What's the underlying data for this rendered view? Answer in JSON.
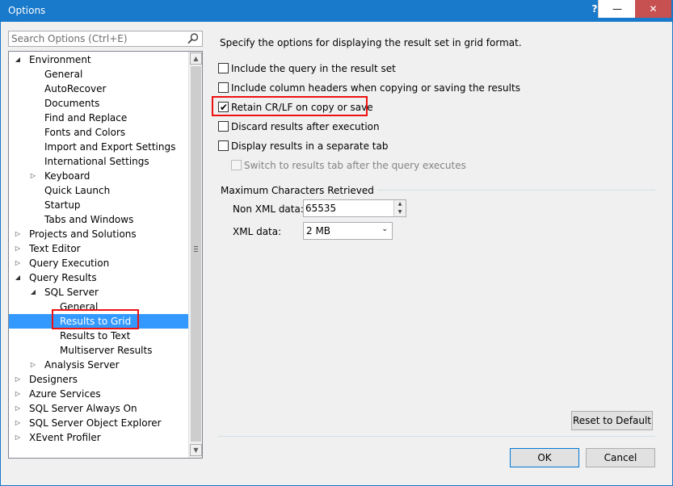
{
  "window": {
    "title": "Options",
    "help_button": "?",
    "minimize_button": "—",
    "close_button": "✕"
  },
  "search": {
    "placeholder": "Search Options (Ctrl+E)"
  },
  "tree": {
    "items": [
      {
        "label": "Environment",
        "level": 0,
        "expander": "expanded"
      },
      {
        "label": "General",
        "level": 1
      },
      {
        "label": "AutoRecover",
        "level": 1
      },
      {
        "label": "Documents",
        "level": 1
      },
      {
        "label": "Find and Replace",
        "level": 1
      },
      {
        "label": "Fonts and Colors",
        "level": 1
      },
      {
        "label": "Import and Export Settings",
        "level": 1
      },
      {
        "label": "International Settings",
        "level": 1
      },
      {
        "label": "Keyboard",
        "level": 1,
        "expander": "collapsed"
      },
      {
        "label": "Quick Launch",
        "level": 1
      },
      {
        "label": "Startup",
        "level": 1
      },
      {
        "label": "Tabs and Windows",
        "level": 1
      },
      {
        "label": "Projects and Solutions",
        "level": 0,
        "expander": "collapsed"
      },
      {
        "label": "Text Editor",
        "level": 0,
        "expander": "collapsed"
      },
      {
        "label": "Query Execution",
        "level": 0,
        "expander": "collapsed"
      },
      {
        "label": "Query Results",
        "level": 0,
        "expander": "expanded"
      },
      {
        "label": "SQL Server",
        "level": 1,
        "expander": "expanded"
      },
      {
        "label": "General",
        "level": 2
      },
      {
        "label": "Results to Grid",
        "level": 2,
        "selected": true
      },
      {
        "label": "Results to Text",
        "level": 2
      },
      {
        "label": "Multiserver Results",
        "level": 2
      },
      {
        "label": "Analysis Server",
        "level": 1,
        "expander": "collapsed"
      },
      {
        "label": "Designers",
        "level": 0,
        "expander": "collapsed"
      },
      {
        "label": "Azure Services",
        "level": 0,
        "expander": "collapsed"
      },
      {
        "label": "SQL Server Always On",
        "level": 0,
        "expander": "collapsed"
      },
      {
        "label": "SQL Server Object Explorer",
        "level": 0,
        "expander": "collapsed"
      },
      {
        "label": "XEvent Profiler",
        "level": 0,
        "expander": "collapsed"
      }
    ]
  },
  "main": {
    "description": "Specify the options for displaying the result set in grid format.",
    "checkboxes": [
      {
        "label": "Include the query in the result set",
        "checked": false
      },
      {
        "label": "Include column headers when copying or saving the results",
        "checked": false
      },
      {
        "label": "Retain CR/LF on copy or save",
        "checked": true
      },
      {
        "label": "Discard results after execution",
        "checked": false
      },
      {
        "label": "Display results in a separate tab",
        "checked": false
      },
      {
        "label": "Switch to results tab after the query executes",
        "checked": false,
        "disabled": true
      }
    ],
    "group_title": "Maximum Characters Retrieved",
    "non_xml_label": "Non XML data:",
    "non_xml_value": "65535",
    "xml_label": "XML data:",
    "xml_value": "2 MB"
  },
  "buttons": {
    "reset": "Reset to Default",
    "ok": "OK",
    "cancel": "Cancel"
  },
  "colors": {
    "title_bar": "#1979ca",
    "selection": "#3399ff",
    "highlight_box": "#ee1111",
    "close_button": "#c75050"
  }
}
